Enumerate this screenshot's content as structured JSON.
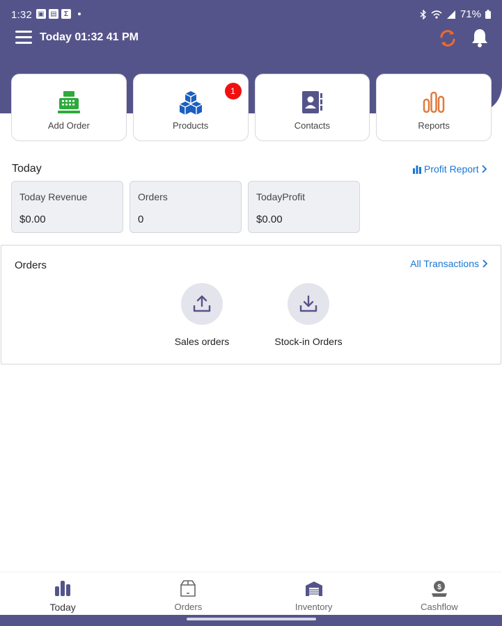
{
  "status_bar": {
    "time": "1:32",
    "battery": "71%"
  },
  "app_bar": {
    "title": "Today 01:32 41 PM"
  },
  "tiles": [
    {
      "label": "Add Order",
      "icon": "cash-register-icon"
    },
    {
      "label": "Products",
      "icon": "boxes-icon",
      "badge": "1"
    },
    {
      "label": "Contacts",
      "icon": "contact-book-icon"
    },
    {
      "label": "Reports",
      "icon": "bar-chart-icon"
    }
  ],
  "today": {
    "title": "Today",
    "profit_link": "Profit Report",
    "stats": [
      {
        "label": "Today Revenue",
        "value": "$0.00"
      },
      {
        "label": "Orders",
        "value": "0"
      },
      {
        "label": "TodayProfit",
        "value": "$0.00"
      }
    ]
  },
  "orders": {
    "title": "Orders",
    "all_link": "All Transactions",
    "actions": [
      {
        "label": "Sales orders",
        "icon": "upload-tray-icon"
      },
      {
        "label": "Stock-in Orders",
        "icon": "download-tray-icon"
      }
    ]
  },
  "bottom_nav": [
    {
      "label": "Today",
      "icon": "bar-chart-icon",
      "active": true
    },
    {
      "label": "Orders",
      "icon": "package-icon"
    },
    {
      "label": "Inventory",
      "icon": "warehouse-icon"
    },
    {
      "label": "Cashflow",
      "icon": "money-bag-icon"
    }
  ],
  "colors": {
    "header": "#55548a",
    "link": "#1976d2",
    "add_order_icon": "#2eaa3c",
    "products_icon": "#1d5fbf",
    "contacts_icon": "#55548a",
    "reports_icon": "#e07a3a",
    "sync_icon": "#f06a2a",
    "badge": "#f01010"
  }
}
